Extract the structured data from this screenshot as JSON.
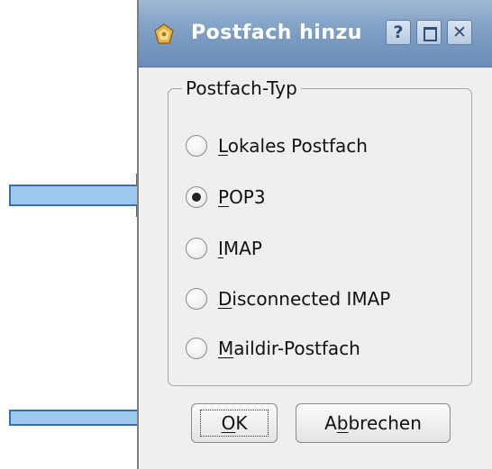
{
  "dialog": {
    "title": "Postfach hinzu",
    "title_full_hint": "",
    "help_btn": "?",
    "close_btn": "✕"
  },
  "group": {
    "title": "Postfach-Typ",
    "options": [
      {
        "mnemonic": "L",
        "rest": "okales Postfach",
        "checked": false
      },
      {
        "mnemonic": "P",
        "rest": "OP3",
        "checked": true
      },
      {
        "mnemonic": "I",
        "rest": "MAP",
        "checked": false
      },
      {
        "mnemonic": "D",
        "rest": "isconnected IMAP",
        "checked": false
      },
      {
        "mnemonic": "M",
        "rest": "aildir-Postfach",
        "checked": false
      }
    ]
  },
  "buttons": {
    "ok_mnemonic": "O",
    "ok_rest": "K",
    "cancel_pre": "A",
    "cancel_mnemonic": "b",
    "cancel_rest": "brechen"
  },
  "colors": {
    "titlebar": "#7f9fc4",
    "arrow_fill": "#9ec8f0",
    "arrow_stroke": "#3a6fb0"
  }
}
